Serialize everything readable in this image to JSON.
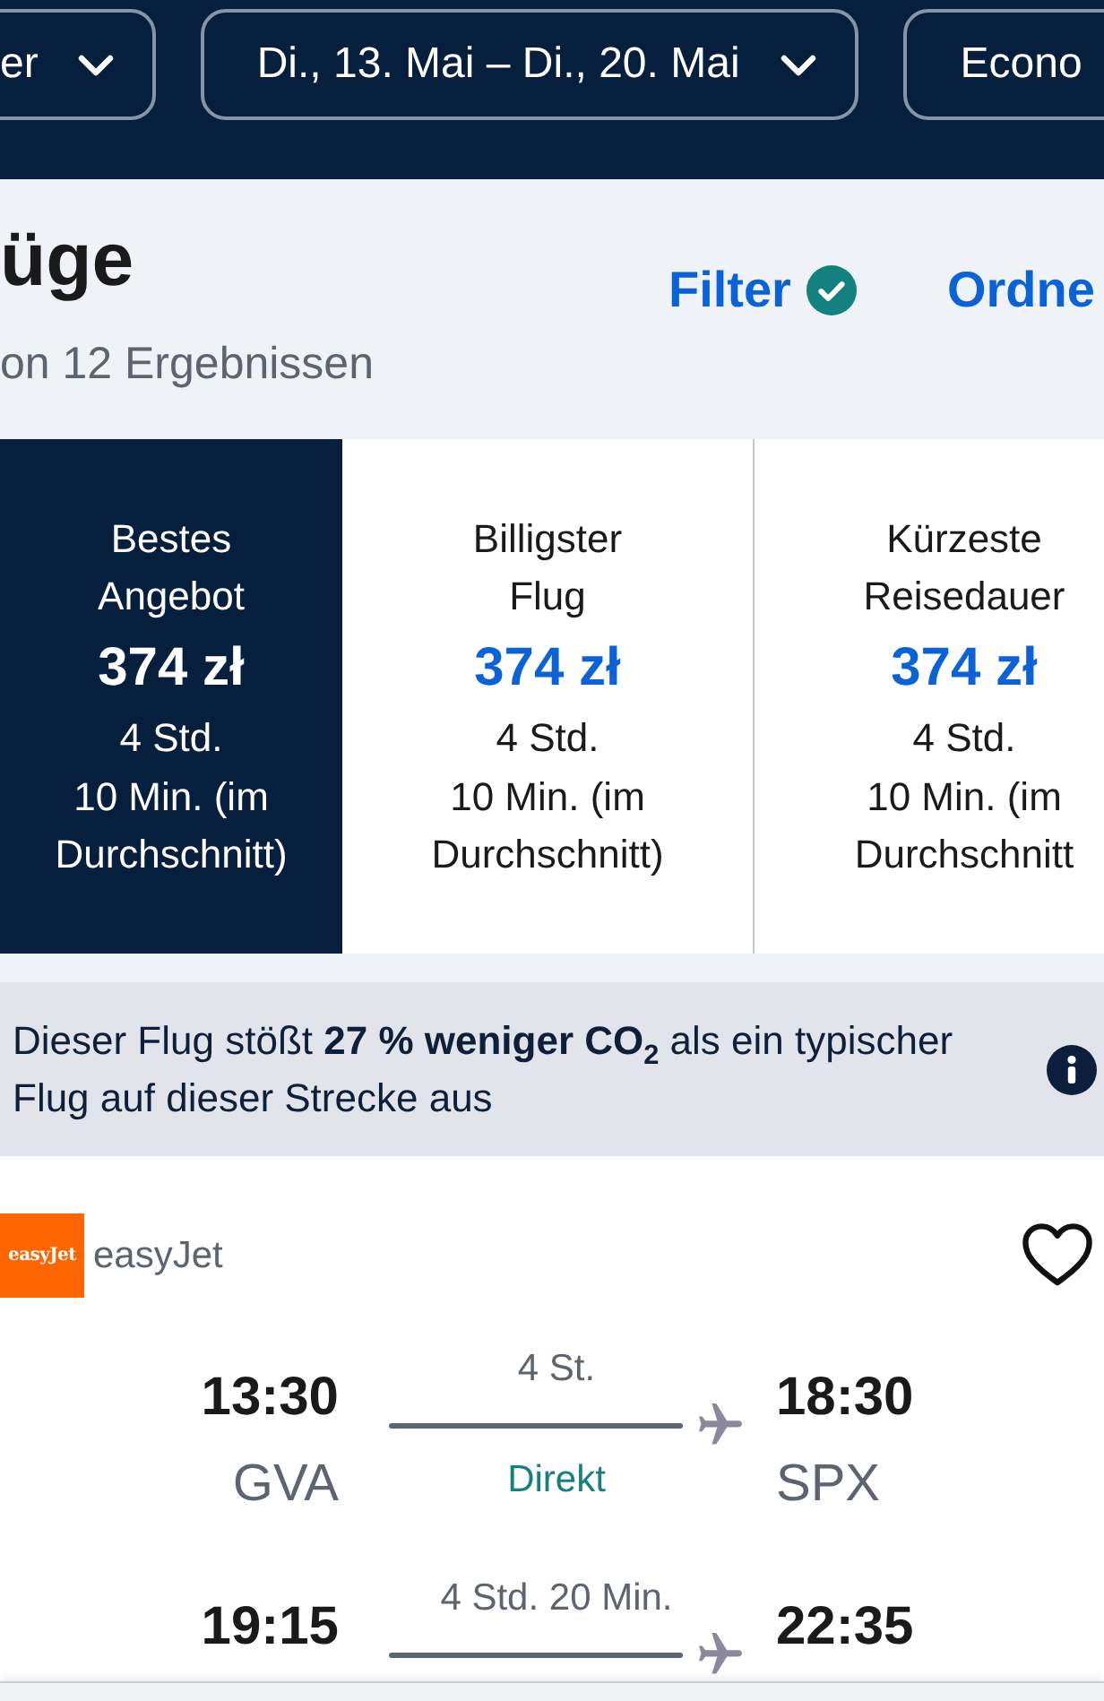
{
  "search_bar": {
    "fields": [
      {
        "value": "er",
        "kind": "dropdown"
      },
      {
        "value": "Di., 13. Mai – Di., 20. Mai",
        "kind": "dropdown"
      },
      {
        "value": "Econo",
        "kind": "plain"
      }
    ]
  },
  "results_header": {
    "title": "üge",
    "subtitle": "on 12 Ergebnissen",
    "filter": {
      "label": "Filter",
      "active": true
    },
    "sort": {
      "label": "Ordne"
    }
  },
  "sort_tabs": [
    {
      "label": "Bestes Angebot",
      "price": "374 zł",
      "duration_lines": [
        "4 Std.",
        "10 Min. (im",
        "Durchschnitt)"
      ],
      "selected": true
    },
    {
      "label": "Billigster Flug",
      "price": "374 zł",
      "duration_lines": [
        "4 Std.",
        "10 Min. (im",
        "Durchschnitt)"
      ],
      "selected": false
    },
    {
      "label": "Kürzeste Reisedauer",
      "price": "374 zł",
      "duration_lines": [
        "4 Std.",
        "10 Min. (im",
        "Durchschnitt"
      ],
      "selected": false
    }
  ],
  "co2_notice": {
    "text": "Dieser Flug stößt **27 % weniger CO$_{2}$** als ein typischer Flug auf dieser Strecke aus"
  },
  "flight_card": {
    "airline": {
      "logo_text": "easyJet",
      "name": "easyJet"
    },
    "saved": false,
    "legs": [
      {
        "departure_time": "13:30",
        "departure_airport": "GVA",
        "duration": "4 St.",
        "stops": "Direkt",
        "arrival_time": "18:30",
        "arrival_airport": "SPX"
      },
      {
        "departure_time": "19:15",
        "duration": "4 Std. 20 Min.",
        "arrival_time": "22:35"
      }
    ]
  }
}
